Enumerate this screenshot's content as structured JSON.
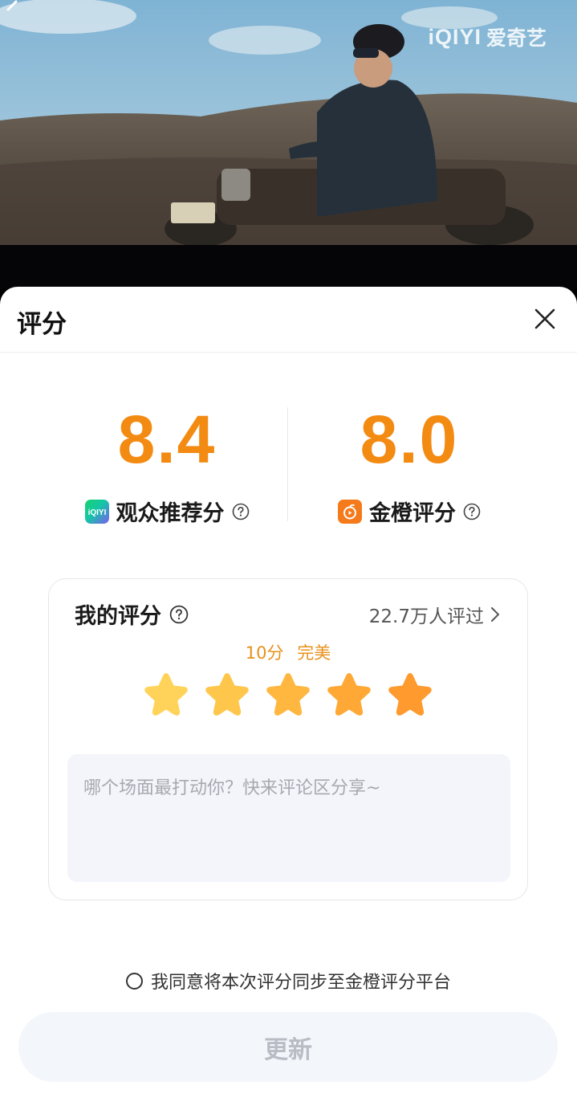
{
  "video": {
    "watermark_en": "iQIYI",
    "watermark_cn": "爱奇艺",
    "back_icon": "back-arrow-icon"
  },
  "sheet": {
    "title": "评分",
    "close_icon": "close-icon"
  },
  "scores": {
    "audience": {
      "value": "8.4",
      "label": "观众推荐分",
      "icon": "iqiyi-logo-icon"
    },
    "jincheng": {
      "value": "8.0",
      "label": "金橙评分",
      "icon": "jincheng-logo-icon"
    }
  },
  "my_rating": {
    "title": "我的评分",
    "rated_count": "22.7万人评过",
    "result_score": "10分",
    "result_text": "完美",
    "stars_selected": 5,
    "stars_total": 5,
    "comment_placeholder": "哪个场面最打动你？快来评论区分享~"
  },
  "agree": {
    "text": "我同意将本次评分同步至金橙评分平台",
    "checked": false
  },
  "update_button": "更新",
  "colors": {
    "accent": "#f38a12",
    "star_start": "#ffd560",
    "star_end": "#ff9a2e"
  }
}
